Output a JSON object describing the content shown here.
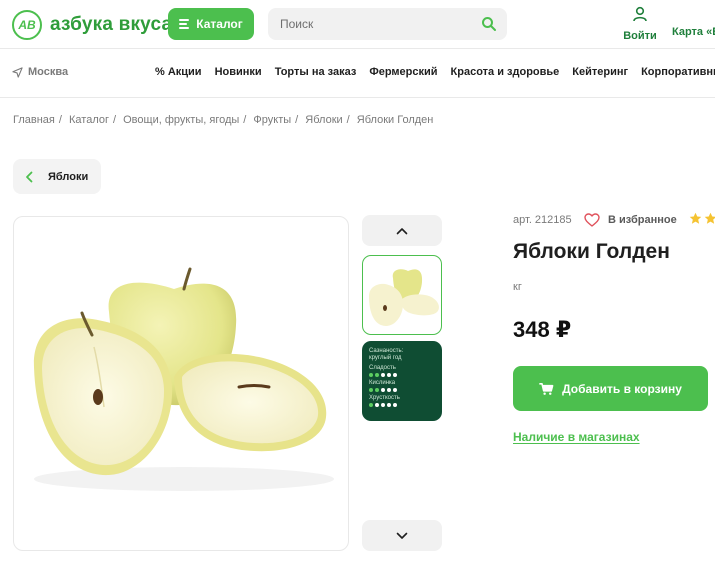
{
  "header": {
    "logo_mark": "AB",
    "logo_text": "азбука вкуса",
    "catalog_label": "Каталог",
    "search_placeholder": "Поиск",
    "login_label": "Войти",
    "map_label": "Карта «Е"
  },
  "nav": {
    "city": "Москва",
    "items": [
      "% Акции",
      "Новинки",
      "Торты на заказ",
      "Фермерский",
      "Красота и здоровье",
      "Кейтеринг",
      "Корпоративным к"
    ]
  },
  "breadcrumb": [
    "Главная",
    "Каталог",
    "Овощи, фрукты, ягоды",
    "Фрукты",
    "Яблоки",
    "Яблоки Голден"
  ],
  "back_label": "Яблоки",
  "gallery": {
    "info_card": {
      "title_line1": "Сазнаность:",
      "title_line2": "круглый год",
      "rows": [
        {
          "label": "Сладость",
          "level": 2,
          "max": 5
        },
        {
          "label": "Кислинка",
          "level": 2,
          "max": 5
        },
        {
          "label": "Хрусткость",
          "level": 1,
          "max": 5
        }
      ]
    }
  },
  "product": {
    "article": "арт. 212185",
    "favorite_label": "В избранное",
    "title": "Яблоки Голден",
    "unit": "кг",
    "price": "348 ₽",
    "add_to_cart_label": "Добавить в корзину",
    "stock_link": "Наличие в магазинах"
  },
  "colors": {
    "brand_green": "#4cbf4e",
    "dark_green": "#0f4d33",
    "star": "#f5c332"
  }
}
